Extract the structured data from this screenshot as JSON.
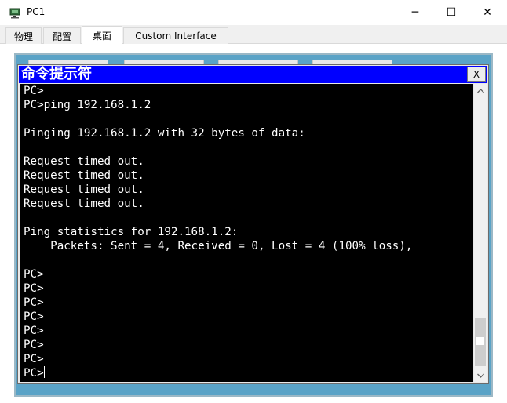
{
  "window": {
    "title": "PC1",
    "minimize_glyph": "─",
    "maximize_glyph": "☐",
    "close_glyph": "✕"
  },
  "tabs": [
    {
      "label": "物理",
      "active": false
    },
    {
      "label": "配置",
      "active": false
    },
    {
      "label": "桌面",
      "active": true
    },
    {
      "label": "Custom Interface",
      "active": false
    }
  ],
  "cmd": {
    "title": "命令提示符",
    "close_label": "X",
    "lines": [
      "PC>",
      "PC>ping 192.168.1.2",
      "",
      "Pinging 192.168.1.2 with 32 bytes of data:",
      "",
      "Request timed out.",
      "Request timed out.",
      "Request timed out.",
      "Request timed out.",
      "",
      "Ping statistics for 192.168.1.2:",
      "    Packets: Sent = 4, Received = 0, Lost = 4 (100% loss),",
      "",
      "PC>",
      "PC>",
      "PC>",
      "PC>",
      "PC>",
      "PC>",
      "PC>",
      "PC>"
    ]
  },
  "colors": {
    "cmd_titlebar": "#0000ff",
    "terminal_bg": "#000000",
    "terminal_fg": "#ffffff",
    "desktop_bg": "#5aa3c7"
  },
  "icons": {
    "app": "packet-tracer-pc-icon",
    "scroll_up": "arrow-up-icon",
    "scroll_down": "arrow-down-icon"
  }
}
